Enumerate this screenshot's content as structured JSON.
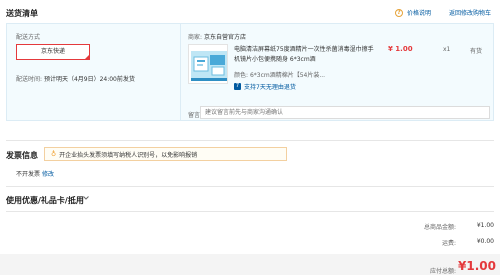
{
  "header": {
    "title": "送货清单",
    "price_note": "价格说明",
    "back_cart": "返回修改购物车"
  },
  "delivery": {
    "method_label": "配送方式",
    "method_option": "京东快递",
    "time_label": "配送时间:",
    "time_value": "预计明天（4月9日）24:00前发货"
  },
  "goods": {
    "merchant_label": "商家:",
    "merchant_name": "京东自营官方店",
    "product": {
      "name": "电脑清洁屏幕纸75度酒精片一次性杀菌消毒湿巾擦手机镜片小包便携随身 6*3cm酒",
      "spec_label": "颜色:",
      "spec_value": "6*3cm酒精棉片【54片装...",
      "return_policy": "支持7天无理由退货",
      "price": "¥ 1.00",
      "qty": "x1",
      "stock": "有货"
    },
    "note_label": "留言:",
    "note_placeholder": "建议留言前先与商家沟通确认"
  },
  "invoice": {
    "title": "发票信息",
    "tip": "开企业抬头发票须填写纳税人识别号，以免影响报销",
    "status": "不开发票",
    "modify": "修改"
  },
  "coupons": {
    "title": "使用优惠/礼品卡/抵用"
  },
  "totals": {
    "amount_label": "总商品金额:",
    "amount_value": "¥1.00",
    "freight_label": "运费:",
    "freight_value": "¥0.00",
    "pay_label": "应付总额:",
    "pay_value": "¥1.00"
  },
  "colors": {
    "accent_red": "#e4393c",
    "link_blue": "#005aa0"
  }
}
